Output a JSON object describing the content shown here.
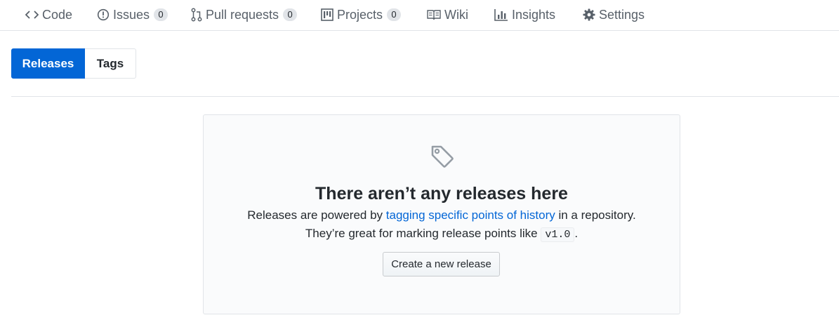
{
  "nav": {
    "items": [
      {
        "label": "Code",
        "icon": "code-icon"
      },
      {
        "label": "Issues",
        "icon": "issue-icon",
        "count": "0"
      },
      {
        "label": "Pull requests",
        "icon": "pull-request-icon",
        "count": "0"
      },
      {
        "label": "Projects",
        "icon": "project-icon",
        "count": "0"
      },
      {
        "label": "Wiki",
        "icon": "book-icon"
      },
      {
        "label": "Insights",
        "icon": "graph-icon"
      },
      {
        "label": "Settings",
        "icon": "gear-icon"
      }
    ]
  },
  "subnav": {
    "releases_label": "Releases",
    "tags_label": "Tags"
  },
  "blankslate": {
    "icon": "tag-icon",
    "title": "There aren’t any releases here",
    "line1_before": "Releases are powered by ",
    "line1_link": "tagging specific points of history",
    "line1_after": " in a repository.",
    "line2_before": "They’re great for marking release points like ",
    "line2_code": "v1.0",
    "line2_after": ".",
    "button_label": "Create a new release"
  },
  "colors": {
    "accent": "#0366d6",
    "nav_text": "#586069",
    "border": "#e1e4e8",
    "blankslate_bg": "#fafbfc"
  }
}
